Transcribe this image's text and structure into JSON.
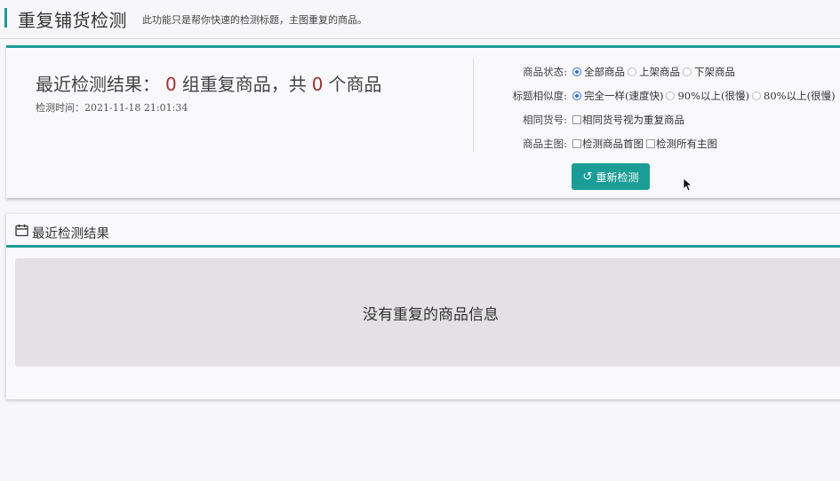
{
  "header": {
    "title": "重复铺货检测",
    "subtitle": "此功能只是帮你快速的检测标题，主图重复的商品。"
  },
  "summary": {
    "prefix": "最近检测结果：",
    "group_count": "0",
    "mid": "组重复商品，共",
    "item_count": "0",
    "suffix": "个商品",
    "time_label": "检测时间：",
    "time_value": "2021-11-18 21:01:34"
  },
  "options": {
    "status": {
      "label": "商品状态:",
      "choices": [
        "全部商品",
        "上架商品",
        "下架商品"
      ],
      "selected": "全部商品"
    },
    "similarity": {
      "label": "标题相似度:",
      "choices": [
        "完全一样(速度快)",
        "90%以上(很慢)",
        "80%以上(很慢)"
      ],
      "selected": "完全一样(速度快)"
    },
    "same_sku": {
      "label": "相同货号:",
      "check_label": "相同货号视为重复商品",
      "checked": false
    },
    "main_image": {
      "label": "商品主图:",
      "checks": [
        "检测商品首图",
        "检测所有主图"
      ]
    }
  },
  "recheck_button": "重新检测",
  "results": {
    "heading": "最近检测结果",
    "empty_message": "没有重复的商品信息"
  },
  "colors": {
    "accent": "#1a9d96",
    "count": "#a5302a",
    "radio": "#2f6fe0"
  }
}
